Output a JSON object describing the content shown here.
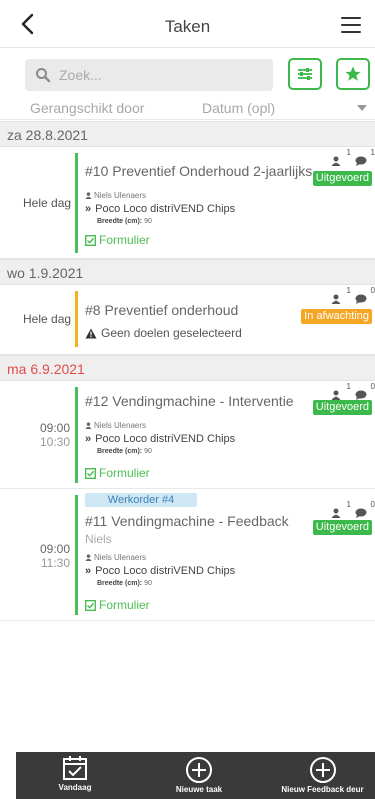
{
  "header": {
    "title": "Taken",
    "back_icon": "chevron-left-icon",
    "menu_icon": "hamburger-icon"
  },
  "search": {
    "placeholder": "Zoek...",
    "value": ""
  },
  "toolbar": {
    "filter_icon": "sliders-icon",
    "favorite_icon": "star-icon",
    "accent": "#3cb94a"
  },
  "sort": {
    "label": "Gerangschikt door",
    "value": "Datum (opl)"
  },
  "groups": [
    {
      "date": "za 28.8.2021",
      "color": "#666666"
    },
    {
      "date": "wo 1.9.2021",
      "color": "#666666"
    },
    {
      "date": "ma 6.9.2021",
      "color": "#e24b4b"
    }
  ],
  "tasks": [
    {
      "all_day": "Hele dag",
      "title": "#10 Preventief Onderhoud 2-jaarlijks",
      "assignee": "Niels Ulenaers",
      "machine": "Poco Loco distriVEND Chips",
      "width_label": "Breedte (cm):",
      "width_value": "90",
      "form": "Formulier",
      "people_count": "1",
      "comment_count": "1",
      "status": "Uitgevoerd"
    },
    {
      "all_day": "Hele dag",
      "title": "#8 Preventief onderhoud",
      "warning": "Geen doelen geselecteerd",
      "people_count": "1",
      "comment_count": "0",
      "status": "In afwachting"
    },
    {
      "time_start": "09:00",
      "time_end": "10:30",
      "title": "#12 Vendingmachine - Interventie",
      "assignee": "Niels Ulenaers",
      "machine": "Poco Loco distriVEND Chips",
      "width_label": "Breedte (cm):",
      "width_value": "90",
      "form": "Formulier",
      "people_count": "1",
      "comment_count": "0",
      "status": "Uitgevoerd"
    },
    {
      "work_order": "Werkorder #4",
      "time_start": "09:00",
      "time_end": "11:30",
      "title": "#11 Vendingmachine - Feedback",
      "subtitle": "Niels",
      "assignee": "Niels Ulenaers",
      "machine": "Poco Loco distriVEND Chips",
      "width_label": "Breedte (cm):",
      "width_value": "90",
      "form": "Formulier",
      "people_count": "1",
      "comment_count": "0",
      "status": "Uitgevoerd"
    }
  ],
  "bottom_nav": [
    {
      "label": "Vandaag",
      "icon": "calendar-check-icon"
    },
    {
      "label": "Nieuwe taak",
      "icon": "plus-circle-icon"
    },
    {
      "label": "Nieuw Feedback deur",
      "icon": "plus-circle-icon"
    }
  ]
}
